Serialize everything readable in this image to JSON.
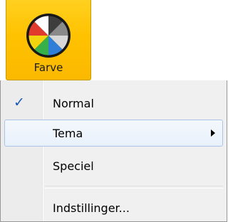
{
  "ribbon_button": {
    "label": "Farve",
    "icon": "color-wheel-icon",
    "bg_color": "#ffc200"
  },
  "menu": {
    "items": [
      {
        "label": "Normal",
        "checked": true,
        "check_glyph": "✓"
      },
      {
        "label": "Tema",
        "has_submenu": true,
        "highlighted": true
      },
      {
        "label": "Speciel"
      },
      {
        "label": "Indstillinger..."
      }
    ],
    "highlight_border_color": "#a8c4e6",
    "check_color": "#1c59b8"
  }
}
